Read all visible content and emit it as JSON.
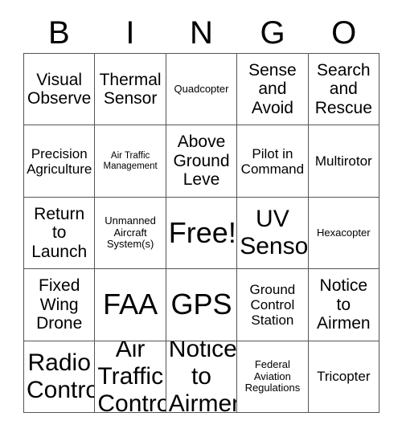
{
  "card": {
    "header_letters": [
      "B",
      "I",
      "N",
      "G",
      "O"
    ],
    "rows": [
      [
        {
          "text": "Visual Observe",
          "size": "lg"
        },
        {
          "text": "Thermal Sensor",
          "size": "lg"
        },
        {
          "text": "Quadcopter",
          "size": "sm"
        },
        {
          "text": "Sense and Avoid",
          "size": "lg"
        },
        {
          "text": "Search and Rescue",
          "size": "lg"
        }
      ],
      [
        {
          "text": "Precision Agriculture",
          "size": "md"
        },
        {
          "text": "Air Traffic Management",
          "size": "xs"
        },
        {
          "text": "Above Ground Leve",
          "size": "lg"
        },
        {
          "text": "Pilot in Command",
          "size": "md"
        },
        {
          "text": "Multirotor",
          "size": "md"
        }
      ],
      [
        {
          "text": "Return to Launch",
          "size": "lg"
        },
        {
          "text": "Unmanned Aircraft System(s)",
          "size": "sm"
        },
        {
          "text": "Free!",
          "size": "xxl"
        },
        {
          "text": "UV Sensor",
          "size": "xl"
        },
        {
          "text": "Hexacopter",
          "size": "sm"
        }
      ],
      [
        {
          "text": "Fixed Wing Drone",
          "size": "lg"
        },
        {
          "text": "FAA",
          "size": "xxl"
        },
        {
          "text": "GPS",
          "size": "xxl"
        },
        {
          "text": "Ground Control Station",
          "size": "md"
        },
        {
          "text": "Notice to Airmen",
          "size": "lg"
        }
      ],
      [
        {
          "text": "Radio Control",
          "size": "xl"
        },
        {
          "text": "Air Traffic Control",
          "size": "xl"
        },
        {
          "text": "Notice to Airmen",
          "size": "xl"
        },
        {
          "text": "Federal Aviation Regulations",
          "size": "sm"
        },
        {
          "text": "Tricopter",
          "size": "md"
        }
      ]
    ]
  },
  "colors": {
    "background": "#ffffff",
    "text": "#000000",
    "grid_line": "#555555"
  }
}
